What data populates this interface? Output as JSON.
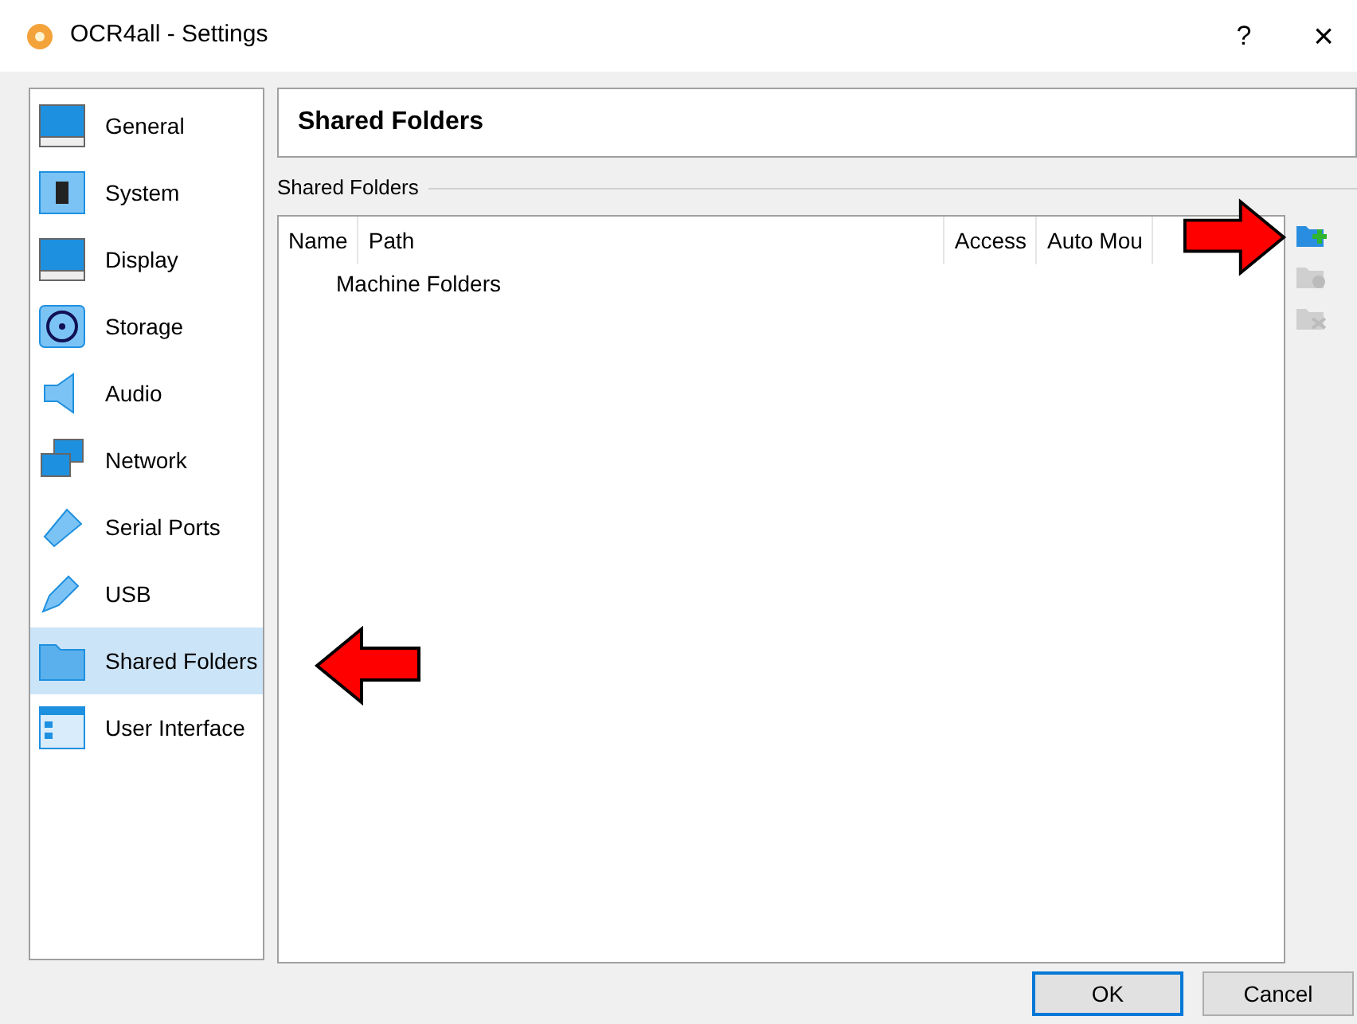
{
  "window": {
    "title": "OCR4all - Settings",
    "help": "?",
    "close": "×"
  },
  "sidebar": {
    "items": [
      {
        "label": "General",
        "selected": false
      },
      {
        "label": "System",
        "selected": false
      },
      {
        "label": "Display",
        "selected": false
      },
      {
        "label": "Storage",
        "selected": false
      },
      {
        "label": "Audio",
        "selected": false
      },
      {
        "label": "Network",
        "selected": false
      },
      {
        "label": "Serial Ports",
        "selected": false
      },
      {
        "label": "USB",
        "selected": false
      },
      {
        "label": "Shared Folders",
        "selected": true
      },
      {
        "label": "User Interface",
        "selected": false
      }
    ]
  },
  "page": {
    "title": "Shared Folders",
    "group_label": "Shared Folders",
    "table": {
      "columns": [
        "Name",
        "Path",
        "Access",
        "Auto Mou"
      ],
      "rows": [
        {
          "name": "Machine Folders"
        }
      ]
    },
    "tool_buttons": [
      {
        "disabled": false
      },
      {
        "disabled": true
      },
      {
        "disabled": true
      }
    ]
  },
  "buttons": [
    {
      "label": "OK",
      "selected": true
    },
    {
      "label": "Cancel",
      "selected": false
    }
  ]
}
